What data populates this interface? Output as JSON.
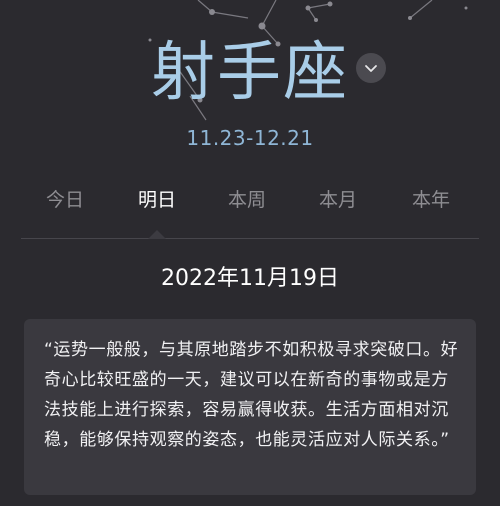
{
  "header": {
    "sign_name": "射手座",
    "date_range": "11.23-12.21",
    "dropdown_icon": "chevron-down-icon"
  },
  "tabs": [
    {
      "label": "今日",
      "active": false
    },
    {
      "label": "明日",
      "active": true
    },
    {
      "label": "本周",
      "active": false
    },
    {
      "label": "本月",
      "active": false
    },
    {
      "label": "本年",
      "active": false
    }
  ],
  "content": {
    "date": "2022年11月19日",
    "fortune": "“运势一般般，与其原地踏步不如积极寻求突破口。好奇心比较旺盛的一天，建议可以在新奇的事物或是方法技能上进行探索，容易赢得收获。生活方面相对沉稳，能够保持观察的姿态，也能灵活应对人际关系。”"
  },
  "colors": {
    "background": "#2b2a2f",
    "accent": "#a9cde8",
    "card": "#3a393f",
    "tab_inactive": "#8e8d92"
  }
}
